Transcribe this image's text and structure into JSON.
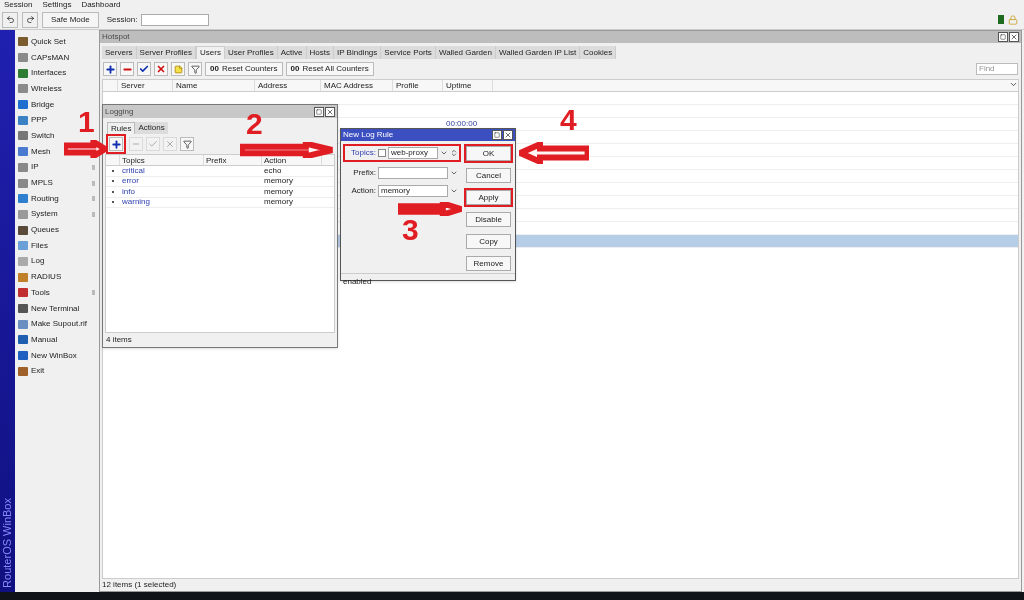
{
  "menu": [
    "Session",
    "Settings",
    "Dashboard"
  ],
  "toolbar": {
    "safe_mode": "Safe Mode",
    "session_label": "Session:"
  },
  "sidebar": {
    "brand": "RouterOS WinBox",
    "items": [
      {
        "label": "Quick Set",
        "submenu": false
      },
      {
        "label": "CAPsMAN",
        "submenu": false
      },
      {
        "label": "Interfaces",
        "submenu": false
      },
      {
        "label": "Wireless",
        "submenu": false
      },
      {
        "label": "Bridge",
        "submenu": false
      },
      {
        "label": "PPP",
        "submenu": false
      },
      {
        "label": "Switch",
        "submenu": false
      },
      {
        "label": "Mesh",
        "submenu": false
      },
      {
        "label": "IP",
        "submenu": true
      },
      {
        "label": "MPLS",
        "submenu": true
      },
      {
        "label": "Routing",
        "submenu": true
      },
      {
        "label": "System",
        "submenu": true
      },
      {
        "label": "Queues",
        "submenu": false
      },
      {
        "label": "Files",
        "submenu": false
      },
      {
        "label": "Log",
        "submenu": false
      },
      {
        "label": "RADIUS",
        "submenu": false
      },
      {
        "label": "Tools",
        "submenu": true
      },
      {
        "label": "New Terminal",
        "submenu": false
      },
      {
        "label": "Make Supout.rif",
        "submenu": false
      },
      {
        "label": "Manual",
        "submenu": false
      },
      {
        "label": "New WinBox",
        "submenu": false
      },
      {
        "label": "Exit",
        "submenu": false
      }
    ]
  },
  "hotspot": {
    "title": "Hotspot",
    "tabs": [
      {
        "label": "Servers",
        "selected": false
      },
      {
        "label": "Server Profiles",
        "selected": false
      },
      {
        "label": "Users",
        "selected": true
      },
      {
        "label": "User Profiles",
        "selected": false
      },
      {
        "label": "Active",
        "selected": false
      },
      {
        "label": "Hosts",
        "selected": false
      },
      {
        "label": "IP Bindings",
        "selected": false
      },
      {
        "label": "Service Ports",
        "selected": false
      },
      {
        "label": "Walled Garden",
        "selected": false
      },
      {
        "label": "Walled Garden IP List",
        "selected": false
      },
      {
        "label": "Cookies",
        "selected": false
      }
    ],
    "buttons": [
      {
        "icon_text": "00",
        "label": "Reset Counters"
      },
      {
        "icon_text": "00",
        "label": "Reset All Counters"
      }
    ],
    "find_placeholder": "Find",
    "columns": [
      "Server",
      "Name",
      "Address",
      "MAC Address",
      "Profile",
      "Uptime"
    ],
    "rows": [
      {
        "selected": false
      },
      {
        "selected": false
      },
      {
        "uptime": "00:00:00",
        "selected": false
      },
      {
        "selected": false
      },
      {
        "selected": false
      },
      {
        "selected": false
      },
      {
        "selected": false
      },
      {
        "selected": false
      },
      {
        "selected": false
      },
      {
        "selected": false
      },
      {
        "selected": false
      },
      {
        "selected": true
      }
    ],
    "status": "12 items (1 selected)"
  },
  "logging": {
    "title": "Logging",
    "tabs": [
      {
        "label": "Rules",
        "selected": true
      },
      {
        "label": "Actions",
        "selected": false
      }
    ],
    "columns": [
      "Topics",
      "Prefix",
      "Action"
    ],
    "rules": [
      {
        "topics": "critical",
        "action": "echo"
      },
      {
        "topics": "error",
        "action": "memory"
      },
      {
        "topics": "info",
        "action": "memory"
      },
      {
        "topics": "warning",
        "action": "memory"
      }
    ],
    "status": "4 items"
  },
  "new_log_rule": {
    "title": "New Log Rule",
    "fields": [
      {
        "kind": "topics",
        "label": "Topics:",
        "checked": false,
        "value": "web-proxy",
        "highlighted": true
      },
      {
        "kind": "select",
        "label": "Prefix:",
        "highlighted": false
      },
      {
        "kind": "select",
        "label": "Action:",
        "value": "memory",
        "highlighted": false
      }
    ],
    "buttons": [
      {
        "label": "OK",
        "highlighted": true
      },
      {
        "label": "Cancel",
        "highlighted": false
      },
      {
        "label": "Apply",
        "highlighted": true
      },
      {
        "label": "Disable",
        "highlighted": false
      },
      {
        "label": "Copy",
        "highlighted": false
      },
      {
        "label": "Remove",
        "highlighted": false
      }
    ],
    "status": "enabled"
  },
  "annotations": [
    "1",
    "2",
    "3",
    "4"
  ]
}
